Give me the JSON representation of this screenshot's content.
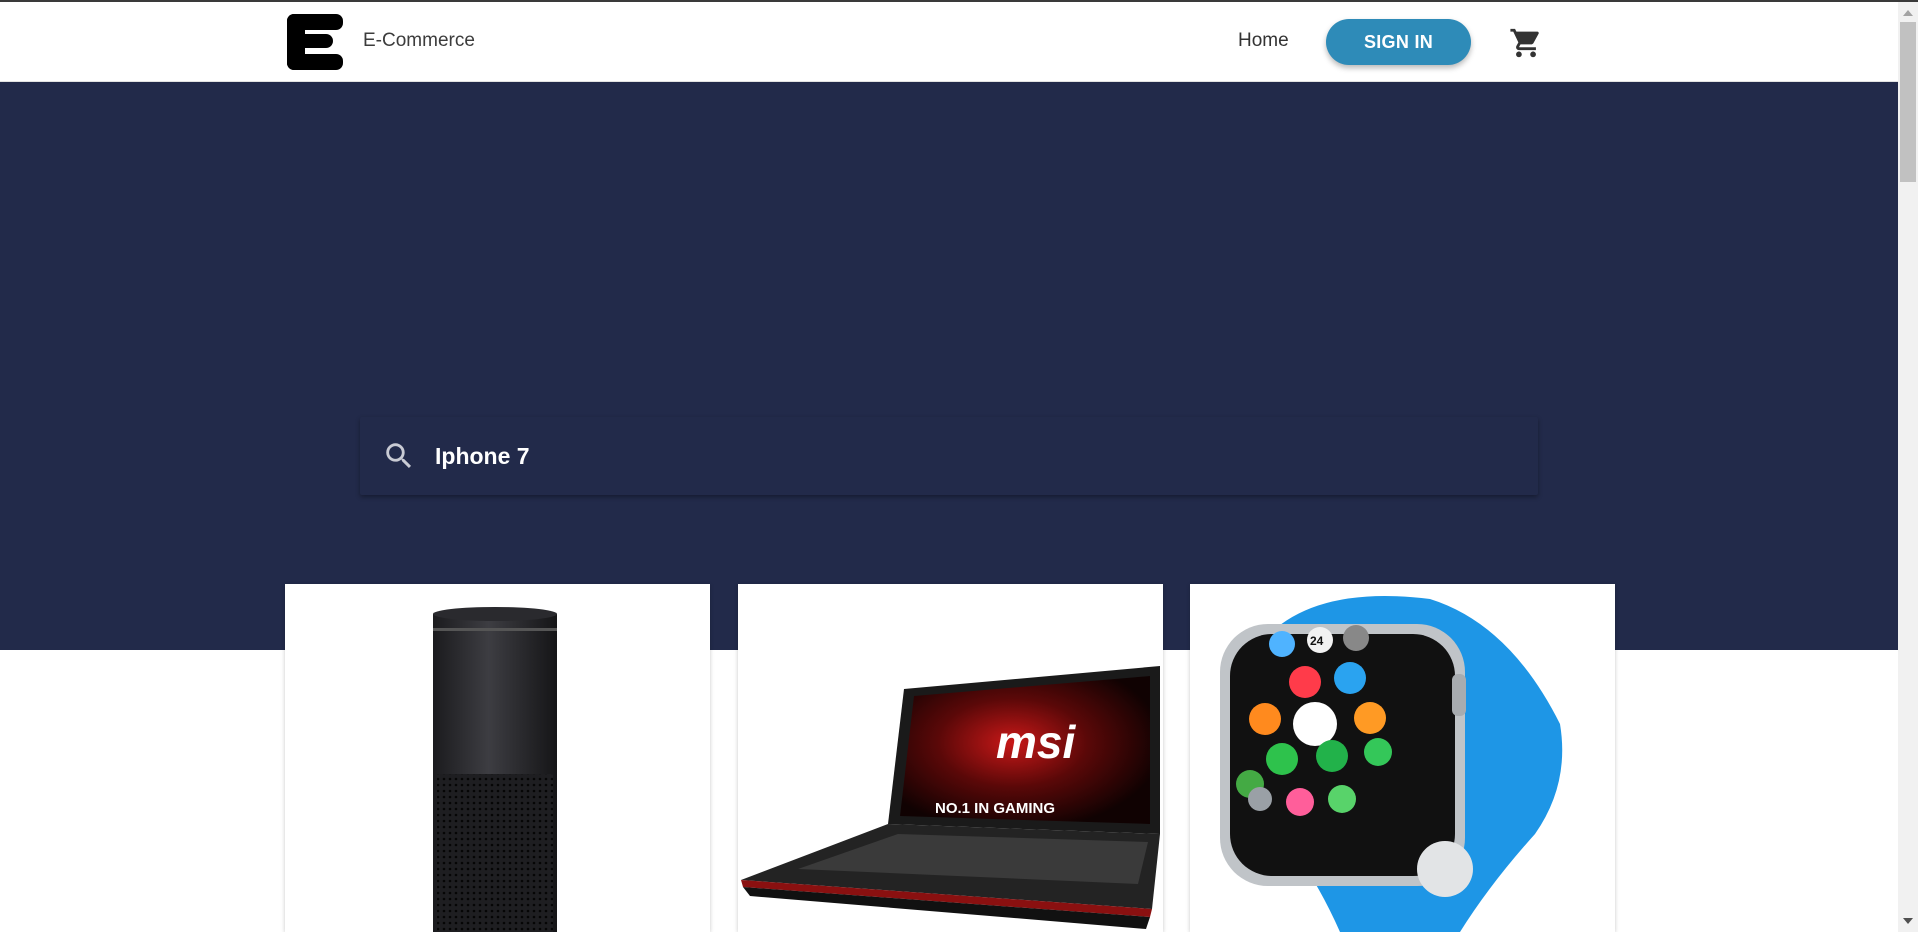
{
  "navbar": {
    "brand": "E-Commerce",
    "home_label": "Home",
    "signin_label": "SIGN IN",
    "cart_icon": "shopping-cart-icon",
    "logo_icon": "e-logo-icon"
  },
  "search": {
    "icon": "search-icon",
    "value": "Iphone 7"
  },
  "products": [
    {
      "image": "smart-speaker-cylinder"
    },
    {
      "image": "msi-gaming-laptop",
      "image_text": [
        "msi",
        "NO.1 IN GAMING"
      ]
    },
    {
      "image": "blue-smartwatch",
      "image_text": [
        "24"
      ]
    }
  ],
  "colors": {
    "hero_bg": "#222a4a",
    "signin_bg": "#2e8bb8",
    "text_dark": "#333333",
    "watch_band": "#1e96e6"
  }
}
